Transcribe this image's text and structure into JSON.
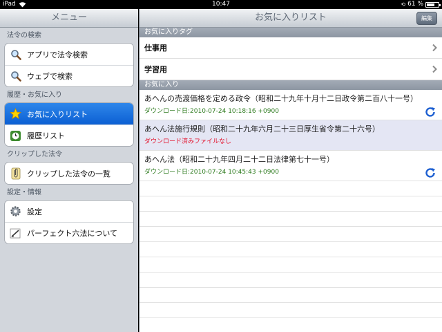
{
  "status_bar": {
    "device": "iPad",
    "time": "10:47",
    "battery": "61 %",
    "battery_level": 0.61
  },
  "left": {
    "title": "メニュー",
    "sections": [
      {
        "header": "法令の検索",
        "items": [
          {
            "label": "アプリで法令検索",
            "icon": "search-icon"
          },
          {
            "label": "ウェブで検索",
            "icon": "search-icon"
          }
        ]
      },
      {
        "header": "履歴・お気に入り",
        "items": [
          {
            "label": "お気に入りリスト",
            "icon": "star-icon",
            "selected": true
          },
          {
            "label": "履歴リスト",
            "icon": "clock-icon"
          }
        ]
      },
      {
        "header": "クリップした法令",
        "items": [
          {
            "label": "クリップした法令の一覧",
            "icon": "paperclip-icon"
          }
        ]
      },
      {
        "header": "設定・情報",
        "items": [
          {
            "label": "設定",
            "icon": "gear-icon"
          },
          {
            "label": "パーフェクト六法について",
            "icon": "pen-icon"
          }
        ]
      }
    ]
  },
  "right": {
    "title": "お気に入りリスト",
    "edit_label": "編集",
    "tags_header": "お気に入りタグ",
    "tags": [
      "仕事用",
      "学習用"
    ],
    "favorites_header": "お気に入り",
    "favorites": [
      {
        "title": "あへんの売渡価格を定める政令（昭和二十九年十月十二日政令第二百八十一号）",
        "sub": "ダウンロード日:2010-07-24 10:18:16 +0900",
        "status": "downloaded"
      },
      {
        "title": "あへん法施行規則（昭和二十九年六月二十三日厚生省令第二十六号）",
        "sub": "ダウンロード済みファイルなし",
        "status": "missing"
      },
      {
        "title": "あへん法（昭和二十九年四月二十二日法律第七十一号）",
        "sub": "ダウンロード日:2010-07-24 10:45:43 +0900",
        "status": "downloaded"
      }
    ]
  },
  "colors": {
    "accent": "#0b5fd3",
    "download_date": "#2c7a1d",
    "no_file": "#e3102a",
    "highlight_row": "#e4e6f4"
  }
}
